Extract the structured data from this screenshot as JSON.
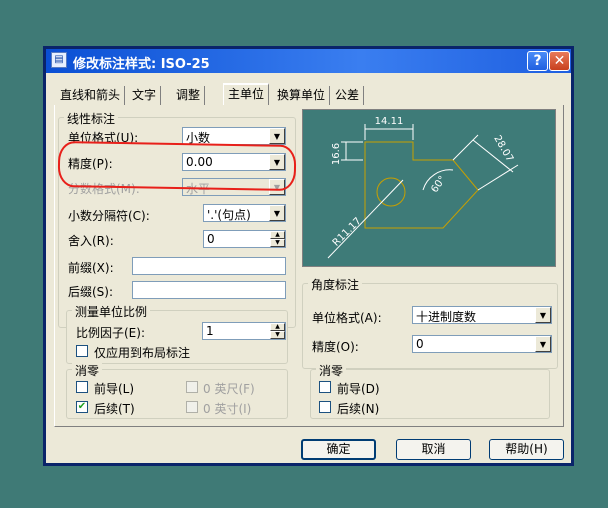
{
  "window": {
    "title": "修改标注样式: ISO-25",
    "help_glyph": "?",
    "close_glyph": "✕",
    "icon": "dialog-app-icon"
  },
  "tabs": [
    {
      "label": "直线和箭头"
    },
    {
      "label": "文字"
    },
    {
      "label": "调整"
    },
    {
      "label": "主单位",
      "active": true
    },
    {
      "label": "换算单位"
    },
    {
      "label": "公差"
    }
  ],
  "linear": {
    "group_title": "线性标注",
    "unit_format_label": "单位格式(U):",
    "unit_format_value": "小数",
    "precision_label": "精度(P):",
    "precision_value": "0.00",
    "fraction_format_label": "分数格式(M):",
    "fraction_format_value": "水平",
    "decimal_separator_label": "小数分隔符(C):",
    "decimal_separator_value": "'.'(句点)",
    "round_off_label": "舍入(R):",
    "round_off_value": "0",
    "prefix_label": "前缀(X):",
    "prefix_value": "",
    "suffix_label": "后缀(S):",
    "suffix_value": ""
  },
  "scale": {
    "group_title": "测量单位比例",
    "factor_label": "比例因子(E):",
    "factor_value": "1",
    "layout_only_label": "仅应用到布局标注",
    "layout_only_checked": false
  },
  "zero_linear": {
    "group_title": "消零",
    "leading_label": "前导(L)",
    "leading_checked": false,
    "trailing_label": "后续(T)",
    "trailing_checked": true,
    "feet_label": "0 英尺(F)",
    "inches_label": "0 英寸(I)"
  },
  "preview": {
    "dim_top": "14.11",
    "dim_left": "16.6",
    "dim_slant": "28.07",
    "dim_angle": "60°",
    "dim_radius": "R11.17"
  },
  "angular": {
    "group_title": "角度标注",
    "unit_format_label": "单位格式(A):",
    "unit_format_value": "十进制度数",
    "precision_label": "精度(O):",
    "precision_value": "0"
  },
  "zero_angular": {
    "group_title": "消零",
    "leading_label": "前导(D)",
    "leading_checked": false,
    "trailing_label": "后续(N)",
    "trailing_checked": false
  },
  "buttons": {
    "ok": "确定",
    "cancel": "取消",
    "help": "帮助(H)"
  },
  "colors": {
    "desktop": "#3f7a76",
    "annotation_ring": "#e8201a",
    "preview_bg": "#3e7b78",
    "preview_lines": "#ffffff",
    "preview_shape": "#c8a000"
  }
}
